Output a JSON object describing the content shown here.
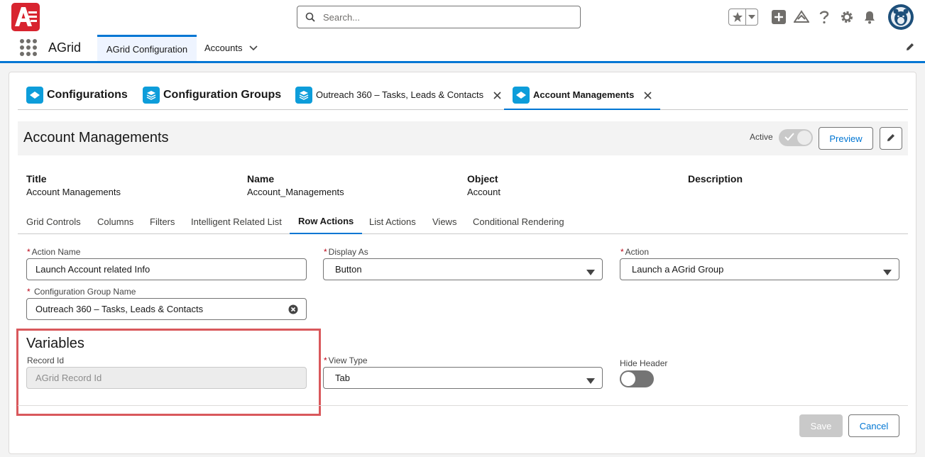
{
  "global_header": {
    "search_placeholder": "Search..."
  },
  "app_nav": {
    "app_name": "AGrid",
    "tabs": [
      {
        "label": "AGrid Configuration",
        "active": true
      },
      {
        "label": "Accounts",
        "active": false
      }
    ]
  },
  "workspace_tabs": [
    {
      "label": "Configurations",
      "closable": false
    },
    {
      "label": "Configuration Groups",
      "closable": false
    },
    {
      "label": "Outreach 360 – Tasks, Leads & Contacts",
      "closable": true
    },
    {
      "label": "Account Managements",
      "closable": true,
      "active": true
    }
  ],
  "record_header": {
    "title": "Account Managements",
    "active_label": "Active",
    "active_on": true,
    "preview_label": "Preview"
  },
  "details": [
    {
      "label": "Title",
      "value": "Account Managements"
    },
    {
      "label": "Name",
      "value": "Account_Managements"
    },
    {
      "label": "Object",
      "value": "Account"
    },
    {
      "label": "Description",
      "value": ""
    }
  ],
  "sub_tabs": [
    {
      "label": "Grid Controls"
    },
    {
      "label": "Columns"
    },
    {
      "label": "Filters"
    },
    {
      "label": "Intelligent Related List"
    },
    {
      "label": "Row Actions",
      "active": true
    },
    {
      "label": "List Actions"
    },
    {
      "label": "Views"
    },
    {
      "label": "Conditional Rendering"
    }
  ],
  "form": {
    "action_name": {
      "label": "Action Name",
      "value": "Launch Account related Info"
    },
    "display_as": {
      "label": "Display As",
      "value": "Button"
    },
    "action": {
      "label": "Action",
      "value": "Launch a AGrid Group"
    },
    "config_group": {
      "label": "Configuration Group Name",
      "value": "Outreach 360 – Tasks, Leads & Contacts"
    },
    "variables_title": "Variables",
    "record_id": {
      "label": "Record Id",
      "placeholder": "AGrid Record Id"
    },
    "view_type": {
      "label": "View Type",
      "value": "Tab"
    },
    "hide_header": {
      "label": "Hide Header",
      "on": false
    }
  },
  "footer": {
    "save_label": "Save",
    "cancel_label": "Cancel"
  },
  "colors": {
    "brand_blue": "#0176d3",
    "logo_red": "#d8242f",
    "highlight_red": "#d9585c",
    "tab_icon_blue": "#0d9dda"
  }
}
